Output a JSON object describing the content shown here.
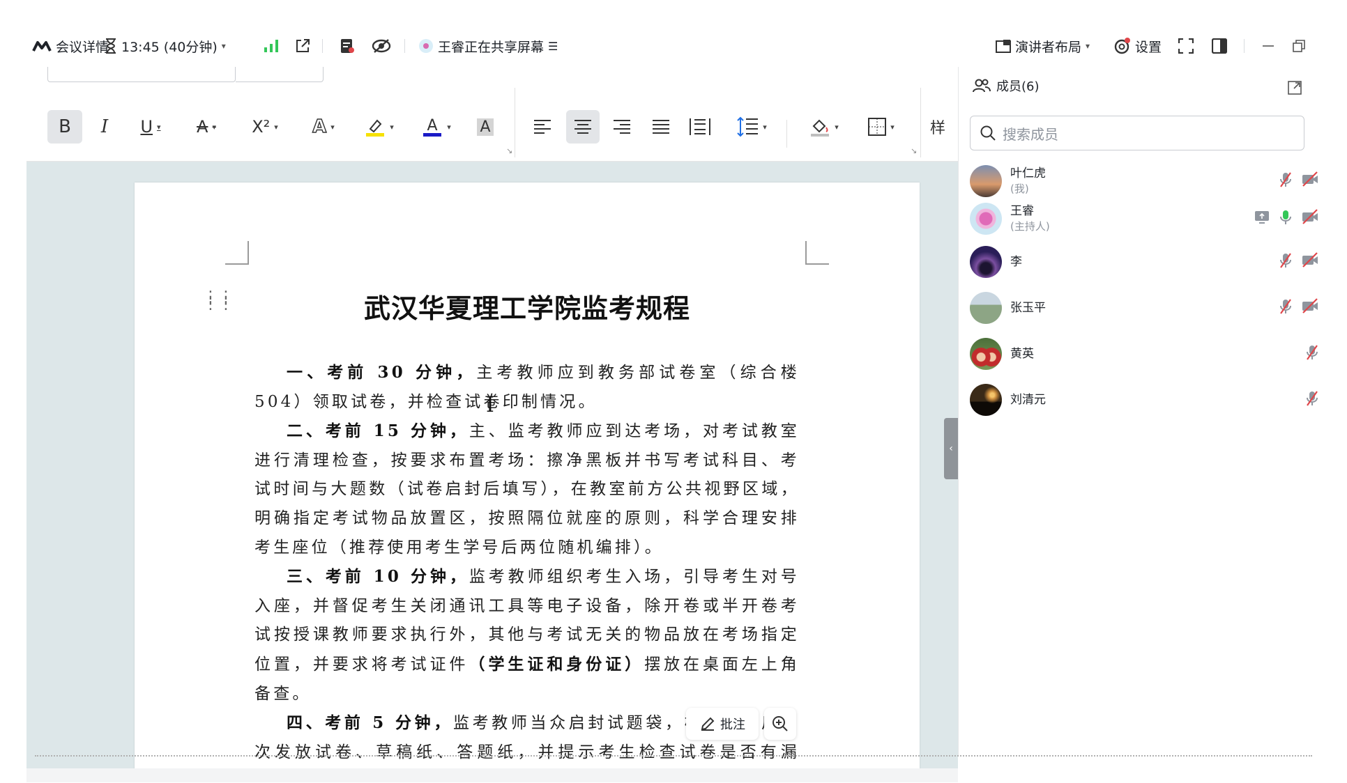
{
  "topbar": {
    "meeting_details": "会议详情",
    "timer": "13:45 (40分钟)",
    "sharing_status": "王睿正在共享屏幕",
    "layout": "演讲者布局",
    "settings": "设置"
  },
  "document": {
    "title": "武汉华夏理工学院监考规程",
    "paragraphs": [
      {
        "bold": "一、考前 30 分钟，",
        "text": "主考教师应到教务部试卷室（综合楼 504）领取试卷，并检查试卷印制情况。"
      },
      {
        "bold": "二、考前 15 分钟，",
        "text": "主、监考教师应到达考场，对考试教室进行清理检查，按要求布置考场：擦净黑板并书写考试科目、考试时间与大题数（试卷启封后填写），在教室前方公共视野区域，明确指定考试物品放置区，按照隔位就座的原则，科学合理安排考生座位（推荐使用考生学号后两位随机编排）。"
      },
      {
        "bold": "三、考前 10 分钟，",
        "text": "监考教师组织考生入场，引导考生对号入座，并督促考生关闭通讯工具等电子设备，除开卷或半开卷考试按授课教师要求执行外，其他与考试无关的物品放在考场指定位置，并要求将考试证件",
        "bold2": "（学生证和身份证）",
        "text2": "摆放在桌面左上角备查。"
      },
      {
        "bold": "四、考前 5 分钟，",
        "text": "监考教师当众启封试题袋，检查无误后依次发放试卷、草稿纸、答题纸，并提示考生检查试卷是否有漏印、错印等情况。"
      }
    ],
    "annotate_button": "批注"
  },
  "members": {
    "header": "成员(6)",
    "search_placeholder": "搜索成员",
    "list": [
      {
        "name": "叶仁虎",
        "role": "(我)",
        "avatar_color": "#c08a6a"
      },
      {
        "name": "王睿",
        "role": "(主持人)",
        "avatar_color": "#c8e2f0"
      },
      {
        "name": "李",
        "role": "",
        "avatar_color": "#3b2a6a"
      },
      {
        "name": "张玉平",
        "role": "",
        "avatar_color": "#8aa28a"
      },
      {
        "name": "黄英",
        "role": "",
        "avatar_color": "#a83232"
      },
      {
        "name": "刘清元",
        "role": "",
        "avatar_color": "#2a2218"
      }
    ]
  },
  "colors": {
    "accent": "#1f6fe5",
    "doc_bg": "#dde7e9",
    "muted_red": "#e0464a",
    "green": "#34c759"
  }
}
